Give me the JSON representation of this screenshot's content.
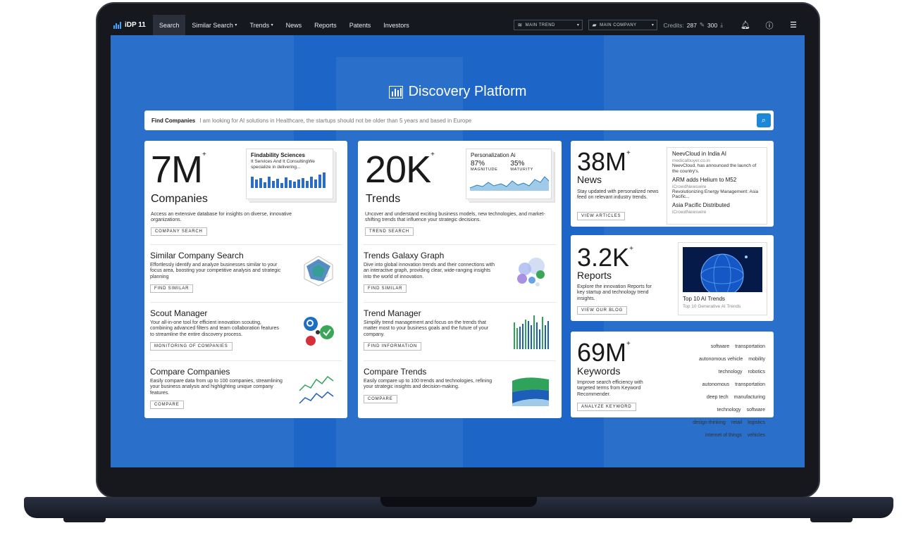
{
  "nav": {
    "logo": "iDP 11",
    "items": [
      "Search",
      "Similar Search",
      "Trends",
      "News",
      "Reports",
      "Patents",
      "Investors"
    ],
    "main_trend": "MAIN TREND",
    "main_company": "MAIN COMPANY",
    "credits_label": "Credits:",
    "credits_value": "287",
    "credits_download": "300"
  },
  "title": "Discovery Platform",
  "search": {
    "label": "Find Companies",
    "placeholder": "I am looking for AI solutions in Healthcare, the startups should not be older than 5 years and based in Europe"
  },
  "companies": {
    "count": "7M",
    "label": "Companies",
    "mini_title": "Findability Sciences",
    "mini_text": "It Services And It ConsultingWe specialize in delivering...",
    "desc": "Access an extensive database for insights on diverse, innovative organizations.",
    "button": "COMPANY SEARCH",
    "sections": [
      {
        "title": "Similar Company Search",
        "desc": "Effortlessly identify and analyze businesses similar to your focus area, boosting your competitive analysis and strategic planning",
        "button": "FIND SIMILAR"
      },
      {
        "title": "Scout Manager",
        "desc": "Your all-in-one tool for efficient innovation scouting, combining advanced filters and team collaboration features to streamline the entire discovery process.",
        "button": "MONITORING OF COMPANIES"
      },
      {
        "title": "Compare Companies",
        "desc": "Easily compare data from up to 100 companies, streamlining your business analysis and highlighting unique company features.",
        "button": "COMPARE"
      }
    ]
  },
  "trends": {
    "count": "20K",
    "label": "Trends",
    "mini_title": "Personalization Ai",
    "magnitude_value": "87%",
    "magnitude_label": "MAGNITUDE",
    "maturity_value": "35%",
    "maturity_label": "MATURITY",
    "desc": "Uncover and understand exciting business models, new technologies, and market-shifting trends that influence your strategic decisions.",
    "button": "TREND SEARCH",
    "sections": [
      {
        "title": "Trends Galaxy Graph",
        "desc": "Dive into global innovation trends and their connections with an interactive graph, providing clear, wide-ranging insights into the world of innovation.",
        "button": "FIND SIMILAR"
      },
      {
        "title": "Trend Manager",
        "desc": "Simplify trend management and focus on the trends that matter most to your business goals and the future of your company.",
        "button": "FIND INFORMATION"
      },
      {
        "title": "Compare Trends",
        "desc": "Easily compare up to 100 trends and technologies, refining your strategic insights and decision-making.",
        "button": "COMPARE"
      }
    ]
  },
  "news": {
    "count": "38M",
    "label": "News",
    "desc": "Stay updated with personalized news feed on relevant industry trends.",
    "button": "VIEW ARTICLES",
    "items": [
      {
        "title": "NeevCloud in India AI",
        "source": "medicalbuyer.co.in",
        "text": "NeevCloud, has announced the launch of the country's."
      },
      {
        "title": "ARM adds Helium to M52",
        "source": "iCrowdNewswire",
        "text": "Revolutionizing Energy Management: Asia Pacific..."
      },
      {
        "title": "Asia Pacific Distributed",
        "source": "iCrowdNewswire",
        "text": ""
      }
    ]
  },
  "reports": {
    "count": "3.2K",
    "label": "Reports",
    "desc": "Explore the innovation Reports for key startup and technology trend insights.",
    "button": "VIEW OUR BLOG",
    "mini_title": "Top 10 AI Trends",
    "mini_sub": "Top 10 Generative AI Trends"
  },
  "keywords": {
    "count": "69M",
    "label": "Keywords",
    "desc": "Improve search efficiency with targeted terms from Keyword Recommender.",
    "button": "ANALYZE KEYWORD",
    "tags": [
      [
        "software",
        "transportation"
      ],
      [
        "autonomous vehicle",
        "mobility"
      ],
      [
        "technology",
        "robotics"
      ],
      [
        "autonomous",
        "transportation"
      ],
      [
        "deep tech",
        "manufacturing"
      ],
      [
        "technology",
        "software"
      ],
      [
        "design thinking",
        "retail",
        "logistics"
      ],
      [
        "internet of things",
        "vehicles"
      ]
    ]
  },
  "plus": "+"
}
